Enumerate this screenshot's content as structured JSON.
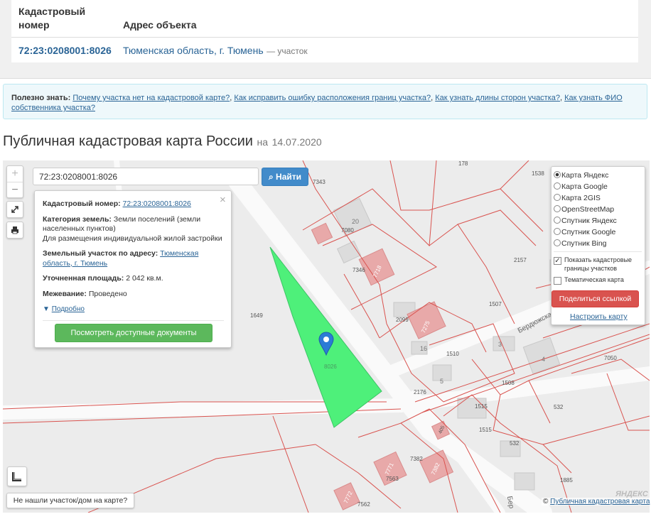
{
  "table": {
    "col1_header_line1": "Кадастровый",
    "col1_header_line2": "номер",
    "col2_header": "Адрес объекта",
    "cad_number": "72:23:0208001:8026",
    "address": "Тюменская область, г. Тюмень",
    "object_type": "— участок"
  },
  "info": {
    "label": "Полезно знать:",
    "links": [
      "Почему участка нет на кадастровой карте?",
      "Как исправить ошибку расположения границ участка?",
      "Как узнать длины сторон участка?",
      "Как узнать ФИО собственника участка?"
    ],
    "separator": ","
  },
  "page": {
    "title": "Публичная кадастровая карта России",
    "date_prefix": "на",
    "date": "14.07.2020"
  },
  "search": {
    "value": "72:23:0208001:8026",
    "button": "Найти"
  },
  "zoom": {
    "in": "+",
    "out": "−"
  },
  "popup": {
    "close": "×",
    "cad_label": "Кадастровый номер:",
    "cad_value": "72:23:0208001:8026",
    "category_label": "Категория земель:",
    "category_value": "Земли поселений (земли населенных пунктов)",
    "usage": "Для размещения индивидуальной жилой застройки",
    "address_label": "Земельный участок по адресу:",
    "address_value": "Тюменская область, г. Тюмень",
    "area_label": "Уточненная площадь:",
    "area_value": "2 042 кв.м.",
    "survey_label": "Межевание:",
    "survey_value": "Проведено",
    "more": "Подробно",
    "docs_button": "Посмотреть доступные документы"
  },
  "layers": {
    "options": [
      "Карта Яндекс",
      "Карта Google",
      "Карта 2GIS",
      "OpenStreetMap",
      "Спутник Яндекс",
      "Спутник Google",
      "Спутник Bing"
    ],
    "selected": "Карта Яндекс",
    "show_borders": "Показать кадастровые границы участков",
    "show_borders_checked": true,
    "thematic": "Тематическая карта",
    "thematic_checked": false,
    "share": "Поделиться ссылкой",
    "setup": "Настроить карту"
  },
  "map_labels": {
    "parcel": "8026",
    "numbers": [
      "7343",
      "178",
      "1538",
      "20",
      "7080",
      "7346",
      "7718",
      "2157",
      "1507",
      "1649",
      "2099",
      "7275",
      "16",
      "3",
      "4",
      "1510",
      "7050",
      "1508",
      "5",
      "2176",
      "1515",
      "532",
      "1515",
      "405",
      "532",
      "7382",
      "7382",
      "7563",
      "7771",
      "1885",
      "7562",
      "7772"
    ],
    "streets": [
      "Бердюжская",
      "Бер"
    ],
    "watermark": "ЯНДЕКС"
  },
  "not_found": "Не нашли участок/дом на карте?",
  "copyright": {
    "symbol": "©",
    "text": "Публичная кадастровая карта"
  },
  "colors": {
    "parcel_fill": "#4ef07a",
    "boundary": "#d9534f",
    "link": "#2a6496",
    "primary": "#428bca",
    "success": "#5cb85c",
    "danger": "#d9534f"
  }
}
